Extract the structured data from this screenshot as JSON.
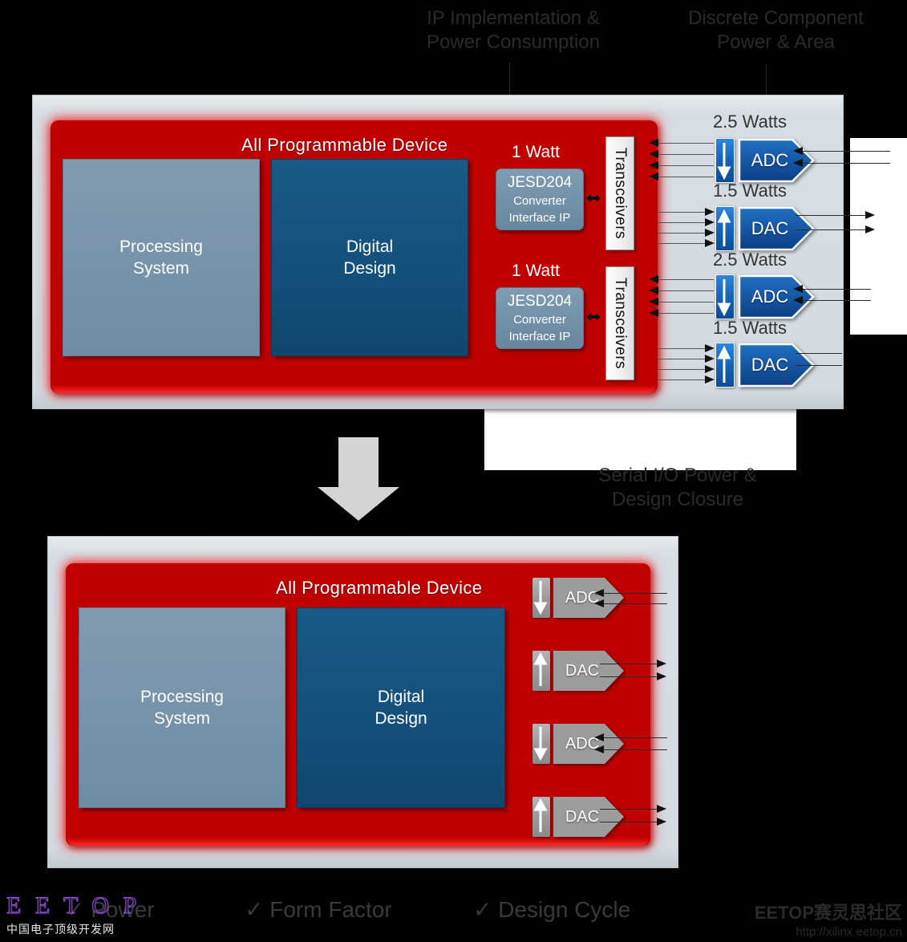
{
  "annotations": {
    "top_left": "IP Implementation &\nPower Consumption",
    "top_left_l1": "IP Implementation &",
    "top_left_l2": "Power Consumption",
    "top_right_l1": "Discrete Component",
    "top_right_l2": "Power & Area",
    "bottom_mid_l1": "Serial I/O Power &",
    "bottom_mid_l2": "Design Closure"
  },
  "top_diagram": {
    "device_title": "All Programmable Device",
    "processing_system_l1": "Processing",
    "processing_system_l2": "System",
    "digital_design_l1": "Digital",
    "digital_design_l2": "Design",
    "ip_blocks": [
      {
        "watt": "1 Watt",
        "l1": "JESD204",
        "l2": "Converter",
        "l3": "Interface IP"
      },
      {
        "watt": "1 Watt",
        "l1": "JESD204",
        "l2": "Converter",
        "l3": "Interface IP"
      }
    ],
    "transceivers": [
      "Transceivers",
      "Transceivers"
    ],
    "converters": [
      {
        "watts": "2.5 Watts",
        "label": "ADC",
        "direction": "down"
      },
      {
        "watts": "1.5 Watts",
        "label": "DAC",
        "direction": "up"
      },
      {
        "watts": "2.5 Watts",
        "label": "ADC",
        "direction": "down"
      },
      {
        "watts": "1.5 Watts",
        "label": "DAC",
        "direction": "up"
      }
    ]
  },
  "bottom_diagram": {
    "device_title": "All Programmable Device",
    "processing_system_l1": "Processing",
    "processing_system_l2": "System",
    "digital_design_l1": "Digital",
    "digital_design_l2": "Design",
    "converters": [
      {
        "label": "ADC",
        "direction": "down"
      },
      {
        "label": "DAC",
        "direction": "up"
      },
      {
        "label": "ADC",
        "direction": "down"
      },
      {
        "label": "DAC",
        "direction": "up"
      }
    ]
  },
  "benefits": [
    {
      "check": "✓",
      "label": "Power"
    },
    {
      "check": "✓",
      "label": "Form Factor"
    },
    {
      "check": "✓",
      "label": "Design Cycle"
    }
  ],
  "watermarks": {
    "left_brand": "E E T O P",
    "left_sub": "中国电子顶级开发网",
    "right_brand": "EETOP赛灵思社区",
    "right_url": "http://xilinx.eetop.cn"
  },
  "colors": {
    "red": "#c00000",
    "panel_gray": "#d3dae1",
    "processing_blue": "#7894ab",
    "digital_blue": "#15507c",
    "converter_blue": "#1263b8",
    "converter_gray": "#9c9c9c",
    "label_gray": "#2b2b2b"
  }
}
